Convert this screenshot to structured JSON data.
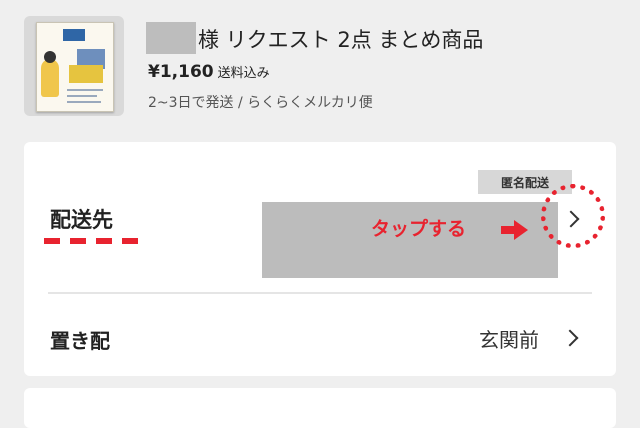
{
  "product": {
    "title": "様 リクエスト 2点 まとめ商品",
    "price": "¥1,160",
    "shipping_included": "送料込み",
    "delivery": "2~3日で発送 / らくらくメルカリ便"
  },
  "shipping": {
    "badge": "匿名配送",
    "destination_label": "配送先",
    "annotation": "タップする",
    "okihai_label": "置き配",
    "okihai_value": "玄関前"
  },
  "colors": {
    "annotation_red": "#e8232f",
    "redaction_gray": "#bcbcbc",
    "background": "#efefef"
  },
  "icons": {
    "chevron": "chevron-right-icon",
    "thumbnail": "book-cover-thumbnail",
    "arrow": "arrow-right-icon"
  }
}
